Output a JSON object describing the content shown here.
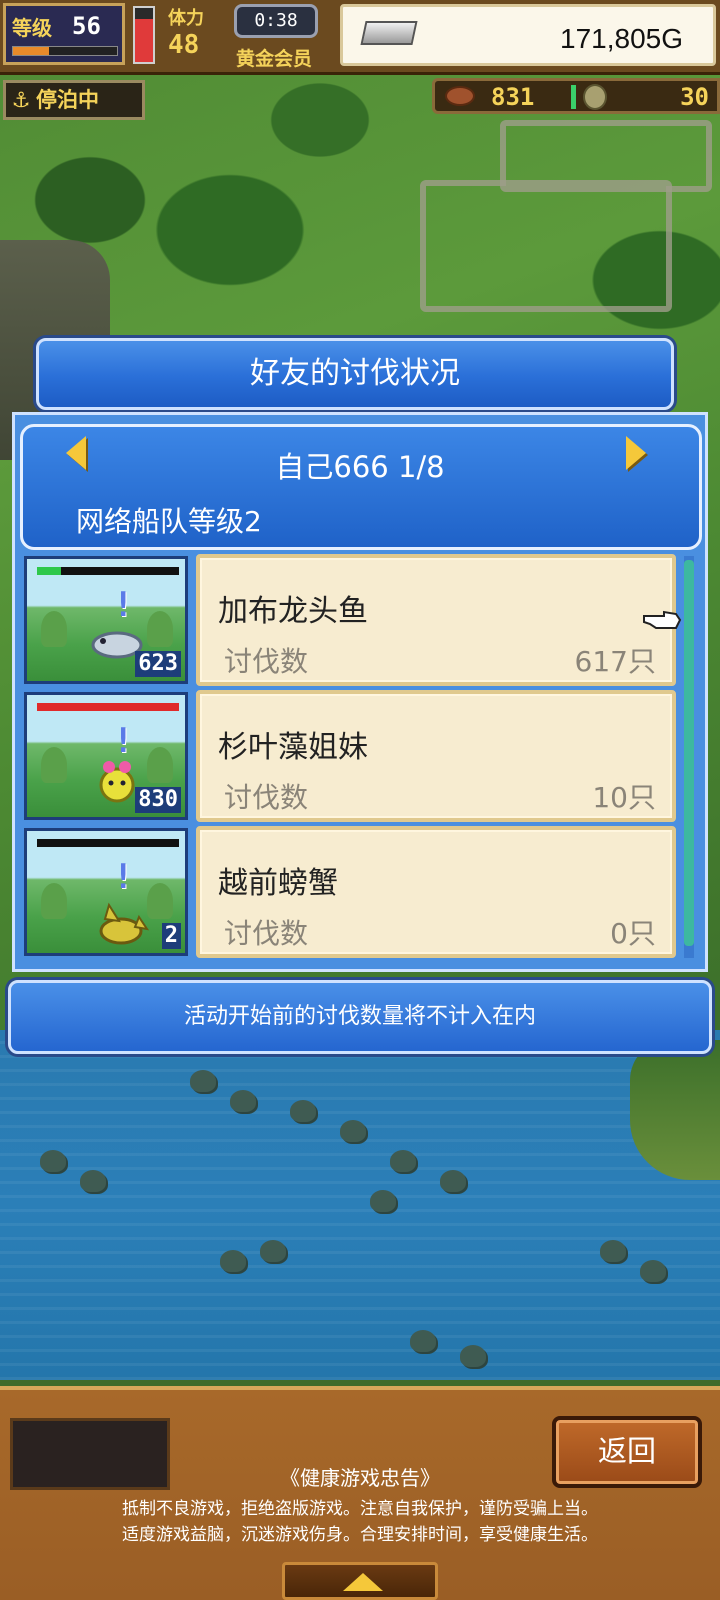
{
  "hud": {
    "level_label": "等级",
    "level_value": "56",
    "exp_progress": 0.35,
    "stamina_label": "体力",
    "stamina_value": "48",
    "stamina_level": 0.8,
    "timer": "0:38",
    "member_label": "黄金会员",
    "gold": "171,805G",
    "anchor_status": "停泊中",
    "meat_value": "831",
    "coin_value": "30"
  },
  "dialog": {
    "title": "好友的讨伐状况",
    "header_title": "自己666 1/8",
    "header_sub": "网络船队等级2",
    "kill_label": "讨伐数",
    "notice": "活动开始前的讨伐数量将不计入在内",
    "rows": [
      {
        "name": "加布龙头鱼",
        "kills": "617只",
        "count": "623",
        "hp": 0.17,
        "hp_color": "#2ec84a"
      },
      {
        "name": "杉叶藻姐妹",
        "kills": "10只",
        "count": "830",
        "hp": 1.0,
        "hp_color": "#e02a2a"
      },
      {
        "name": "越前螃蟹",
        "kills": "0只",
        "count": "2",
        "hp": 0.0,
        "hp_color": "#e02a2a"
      }
    ]
  },
  "bottom": {
    "back_label": "返回",
    "health_title": "《健康游戏忠告》",
    "health_line1": "抵制不良游戏，拒绝盗版游戏。注意自我保护，谨防受骗上当。",
    "health_line2": "适度游戏益脑，沉迷游戏伤身。合理安排时间，享受健康生活。"
  },
  "icons": [
    "anchor-icon",
    "silver-ingot-icon",
    "meat-icon",
    "coin-icon",
    "hand-pointer-icon",
    "arrow-left-icon",
    "arrow-right-icon",
    "expand-up-icon"
  ]
}
